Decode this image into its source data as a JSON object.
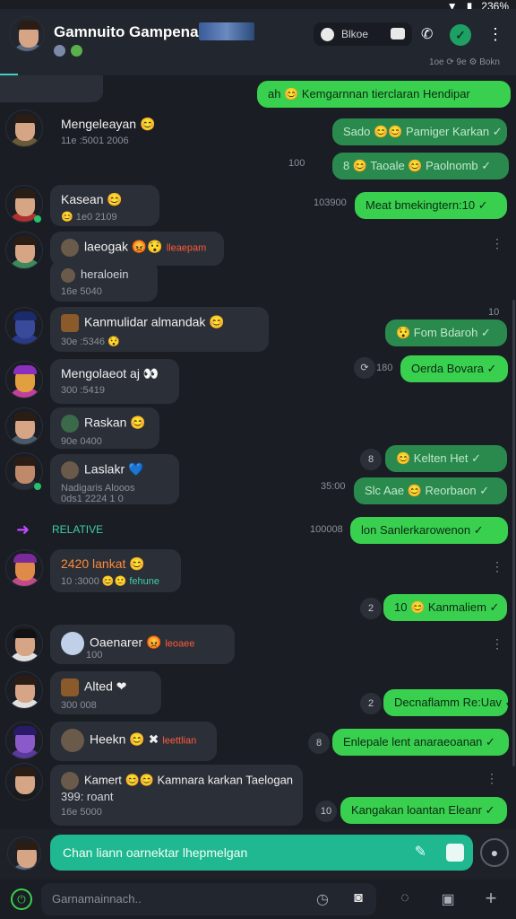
{
  "status": {
    "battery": "236%"
  },
  "header": {
    "title": "Gamnuito Gampena'!",
    "search_label": "Blkoe",
    "meta": "1oe  ⟳ 9e  ⚙ Bokn",
    "more": "⋮",
    "call": "✆",
    "accept": "✓"
  },
  "messages_in": [
    {
      "name": "Mengeleayan 😊",
      "time": "11e :5001 2006"
    },
    {
      "name": "Kasean 😊",
      "time": "😊 1e0  2109"
    },
    {
      "name": "laeogak 😡😯",
      "badge": "lleaepam",
      "sub": "heraloein",
      "time": "16e  5040"
    },
    {
      "name": "Kanmulidar almandak 😊",
      "time": "30e :5346  😯"
    },
    {
      "name": "Mengolaeot aj 👀",
      "time": "300  :5419"
    },
    {
      "name": "Raskan 😊",
      "time": "90e  0400"
    },
    {
      "name": "Laslakr 💙",
      "sub": "Nadigaris Alooos",
      "time": "0ds1 2224 1 0"
    },
    {
      "name": "2420 lankat 😊",
      "badge": "fehune",
      "time": "10 :3000 😊🙂"
    },
    {
      "name": "Oaenarer 😡",
      "badge": "leoaee",
      "time": "100"
    },
    {
      "name": "Alted ❤",
      "time": "300  008"
    },
    {
      "name": "Heekn 😊 ✖",
      "badge": "leettlian",
      "time": ""
    },
    {
      "name": "Kamert 😊😊 Kamnara karkan Taelogan",
      "sub": "399: roant",
      "time": "16e  5000"
    }
  ],
  "messages_out": [
    {
      "text": "ah 😊 Kemgarnnan tierclaran Hendipar",
      "style": "bright"
    },
    {
      "text": "Sado 😊😊 Pamiger Karkan ✓",
      "style": "dim"
    },
    {
      "text": "8 😊 Taoale 😊 Paolnomb ✓",
      "style": "dim",
      "ts": "100"
    },
    {
      "text": "Meat bmekingtern:10 ✓",
      "style": "bright",
      "ts": "103900"
    },
    {
      "text": "😯 Fom Bdaroh ✓",
      "style": "dim",
      "ts": "10"
    },
    {
      "text": "Oerda Bovara ✓",
      "style": "bright",
      "ts": "180"
    },
    {
      "text": "😊 Kelten Het ✓",
      "style": "dim",
      "count": "8"
    },
    {
      "text": "Slc Aae 😊 Reorbaon ✓",
      "style": "dim",
      "ts": "35:00"
    },
    {
      "text": "lon Sanlerkarowenon ✓",
      "style": "bright",
      "ts": "100008"
    },
    {
      "text": "10 😊 Kanmaliem ✓",
      "style": "bright",
      "count": "2"
    },
    {
      "text": "Decnaflamm Re:Uav ✓",
      "style": "bright",
      "count": "2"
    },
    {
      "text": "Enlepale lent anaraeoanan ✓",
      "style": "bright",
      "count": "8"
    },
    {
      "text": "Kangakan loantan Eleanr ✓",
      "style": "bright",
      "count": "10"
    }
  ],
  "separator": {
    "label": "RELATIVE"
  },
  "composer": {
    "placeholder": "Chan liann oarnektar lhepmelgan"
  },
  "bottom": {
    "placeholder": "Garnamainnach.."
  }
}
